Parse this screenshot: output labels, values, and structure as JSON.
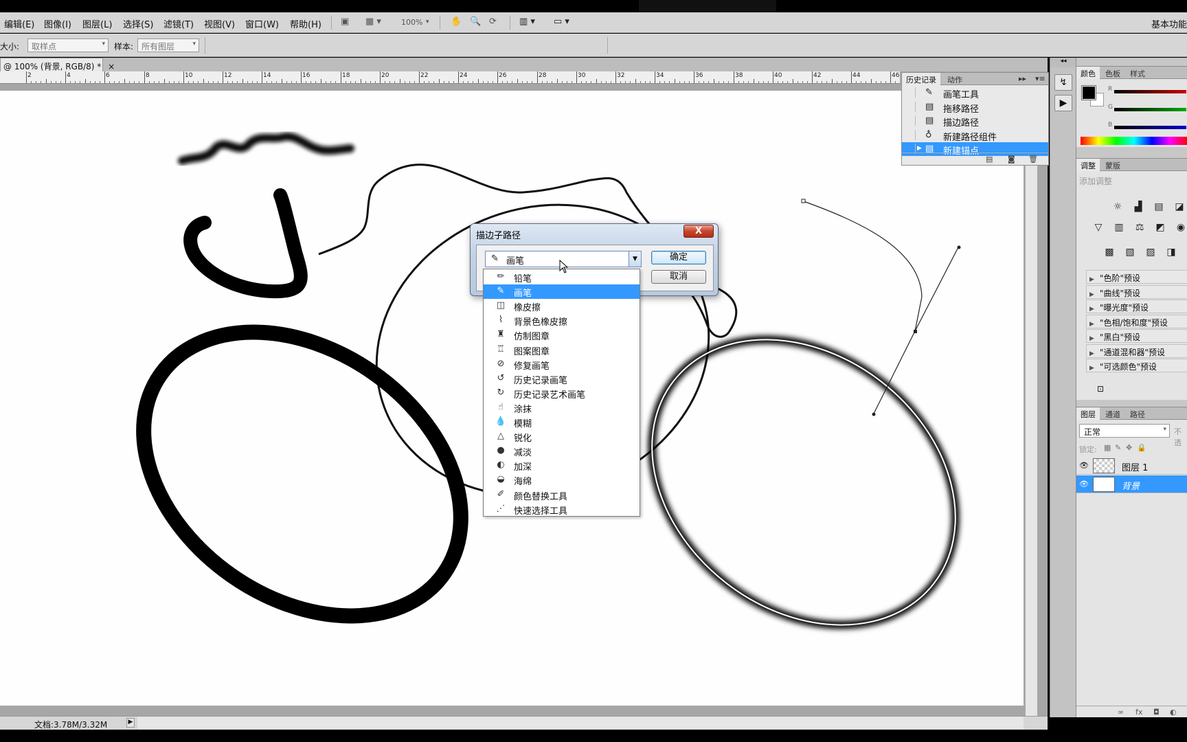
{
  "menubar": {
    "items": [
      "编辑(E)",
      "图像(I)",
      "图层(L)",
      "选择(S)",
      "滤镜(T)",
      "视图(V)",
      "窗口(W)",
      "帮助(H)"
    ],
    "zoom": "100%",
    "workspace": "基本功能"
  },
  "options": {
    "size_label": "大小:",
    "size_value": "取样点",
    "sample_label": "样本:",
    "sample_value": "所有图层"
  },
  "document": {
    "tab_title": "@ 100% (背景, RGB/8) *",
    "tab_close": "×",
    "ruler_labels": [
      "2",
      "4",
      "6",
      "8",
      "10",
      "12",
      "14",
      "16",
      "18",
      "20",
      "22",
      "24",
      "26",
      "28",
      "30",
      "32",
      "34",
      "36",
      "38",
      "40",
      "42",
      "44",
      "46"
    ],
    "status": "文档:3.78M/3.32M",
    "status_arrow": "▶"
  },
  "history_panel": {
    "tabs": [
      "历史记录",
      "动作"
    ],
    "rows": [
      {
        "icon": "brush-icon",
        "glyph": "✎",
        "label": "画笔工具",
        "selected": false
      },
      {
        "icon": "history-state-icon",
        "glyph": "▤",
        "label": "拖移路径",
        "selected": false
      },
      {
        "icon": "history-state-icon",
        "glyph": "▤",
        "label": "描边路径",
        "selected": false
      },
      {
        "icon": "pen-tool-icon",
        "glyph": "♁",
        "label": "新建路径组件",
        "selected": false
      },
      {
        "icon": "history-state-icon",
        "glyph": "▤",
        "label": "新建锚点",
        "selected": true
      }
    ]
  },
  "color_panel": {
    "tabs": [
      "颜色",
      "色板",
      "样式"
    ],
    "channels": [
      "R",
      "G",
      "B"
    ],
    "fg_color": "#000000",
    "bg_color": "#ffffff"
  },
  "adjust_panel": {
    "tabs": [
      "调整",
      "蒙版"
    ],
    "add_label": "添加调整",
    "presets": [
      "\"色阶\"预设",
      "\"曲线\"预设",
      "\"曝光度\"预设",
      "\"色相/饱和度\"预设",
      "\"黑白\"预设",
      "\"通道混和器\"预设",
      "\"可选颜色\"预设"
    ]
  },
  "layers_panel": {
    "tabs": [
      "图层",
      "通道",
      "路径"
    ],
    "blend_mode": "正常",
    "opacity_abbrev": "不透",
    "lock_label": "锁定:",
    "layers": [
      {
        "name": "图层 1",
        "selected": false
      },
      {
        "name": "背景",
        "selected": true
      }
    ]
  },
  "dialog": {
    "title": "描边子路径",
    "close": "X",
    "selected_tool": "画笔",
    "ok_label": "确定",
    "cancel_label": "取消",
    "options": [
      {
        "icon": "pencil-icon",
        "glyph": "✏",
        "label": "铅笔"
      },
      {
        "icon": "brush-icon",
        "glyph": "✎",
        "label": "画笔",
        "selected": true
      },
      {
        "icon": "eraser-icon",
        "glyph": "◫",
        "label": "橡皮擦"
      },
      {
        "icon": "background-eraser-icon",
        "glyph": "⌇",
        "label": "背景色橡皮擦"
      },
      {
        "icon": "clone-stamp-icon",
        "glyph": "♜",
        "label": "仿制图章"
      },
      {
        "icon": "pattern-stamp-icon",
        "glyph": "♖",
        "label": "图案图章"
      },
      {
        "icon": "healing-brush-icon",
        "glyph": "⊘",
        "label": "修复画笔"
      },
      {
        "icon": "history-brush-icon",
        "glyph": "↺",
        "label": "历史记录画笔"
      },
      {
        "icon": "art-history-brush-icon",
        "glyph": "↻",
        "label": "历史记录艺术画笔"
      },
      {
        "icon": "smudge-icon",
        "glyph": "☝",
        "label": "涂抹"
      },
      {
        "icon": "blur-icon",
        "glyph": "💧",
        "label": "模糊"
      },
      {
        "icon": "sharpen-icon",
        "glyph": "△",
        "label": "锐化"
      },
      {
        "icon": "dodge-icon",
        "glyph": "●",
        "label": "减淡"
      },
      {
        "icon": "burn-icon",
        "glyph": "◐",
        "label": "加深"
      },
      {
        "icon": "sponge-icon",
        "glyph": "◒",
        "label": "海绵"
      },
      {
        "icon": "color-replacement-icon",
        "glyph": "✐",
        "label": "颜色替换工具"
      },
      {
        "icon": "quick-selection-icon",
        "glyph": "⋰",
        "label": "快速选择工具"
      }
    ]
  }
}
